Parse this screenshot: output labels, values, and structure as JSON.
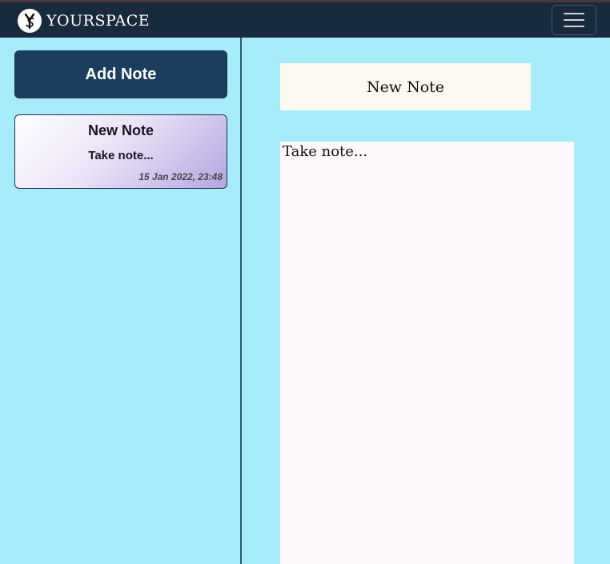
{
  "navbar": {
    "brand": "YOURSPACE",
    "logo_icon": "ys-monogram-icon",
    "menu_icon": "hamburger-icon",
    "background": "#1a2a3d"
  },
  "sidebar": {
    "add_button_label": "Add Note",
    "notes": [
      {
        "title": "New Note",
        "preview": "Take note...",
        "date": "15 Jan 2022, 23:48"
      }
    ]
  },
  "editor": {
    "title_value": "New Note",
    "body_value": "Take note..."
  },
  "colors": {
    "page_background": "#a6ecfa",
    "accent_button": "#1c3e5e",
    "title_field": "#fcf9f0",
    "body_field": "#fef7fc"
  }
}
